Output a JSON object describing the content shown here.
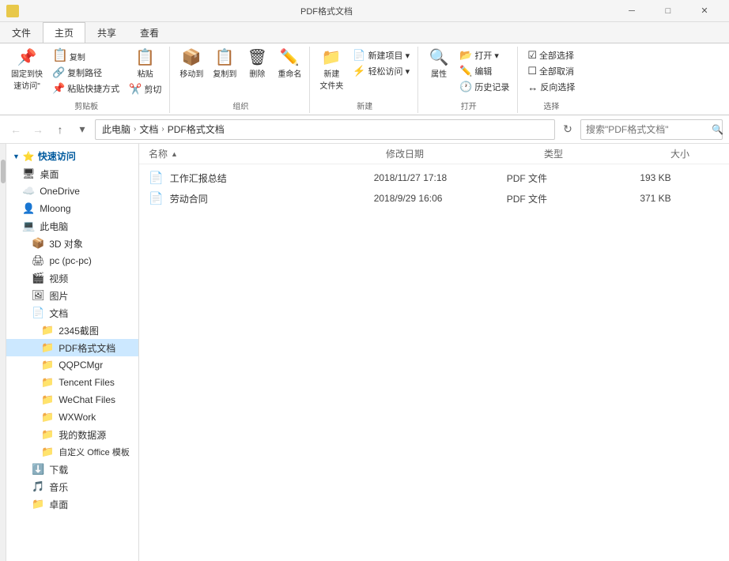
{
  "titleBar": {
    "title": "PDF格式文档",
    "icon": "📁",
    "controls": {
      "minimize": "─",
      "maximize": "□",
      "close": "✕"
    }
  },
  "ribbonTabs": [
    {
      "id": "file",
      "label": "文件",
      "active": false
    },
    {
      "id": "home",
      "label": "主页",
      "active": true
    },
    {
      "id": "share",
      "label": "共享",
      "active": false
    },
    {
      "id": "view",
      "label": "查看",
      "active": false
    }
  ],
  "ribbonGroups": [
    {
      "id": "clipboard",
      "label": "剪贴板",
      "items": [
        {
          "icon": "📌",
          "label": "固定到快\n速访问\"",
          "type": "large"
        },
        {
          "icon": "📋",
          "label": "复制",
          "type": "large"
        },
        {
          "icon": "📌",
          "label": "粘贴",
          "type": "large"
        },
        {
          "subItems": [
            {
              "icon": "🔗",
              "label": "复制路径"
            },
            {
              "icon": "🔗",
              "label": "粘贴快捷方式"
            },
            {
              "icon": "✂️",
              "label": "剪切"
            }
          ]
        }
      ]
    },
    {
      "id": "organize",
      "label": "组织",
      "items": [
        {
          "icon": "📦",
          "label": "移动到",
          "type": "large"
        },
        {
          "icon": "📋",
          "label": "复制到",
          "type": "large"
        },
        {
          "icon": "🗑",
          "label": "删除",
          "type": "large"
        },
        {
          "icon": "✏️",
          "label": "重命名",
          "type": "large"
        }
      ]
    },
    {
      "id": "new",
      "label": "新建",
      "items": [
        {
          "icon": "📁",
          "label": "新建\n文件夹",
          "type": "large"
        },
        {
          "subItems": [
            {
              "icon": "📄",
              "label": "新建项目 ▾"
            },
            {
              "icon": "⚡",
              "label": "轻松访问 ▾"
            }
          ]
        }
      ]
    },
    {
      "id": "open",
      "label": "打开",
      "items": [
        {
          "icon": "🔍",
          "label": "属性",
          "type": "large"
        },
        {
          "subItems": [
            {
              "icon": "📂",
              "label": "打开 ▾"
            },
            {
              "icon": "✏️",
              "label": "编辑"
            },
            {
              "icon": "🕐",
              "label": "历史记录"
            }
          ]
        }
      ]
    },
    {
      "id": "select",
      "label": "选择",
      "items": [
        {
          "subItems": [
            {
              "icon": "☑",
              "label": "全部选择"
            },
            {
              "icon": "☐",
              "label": "全部取消"
            },
            {
              "icon": "↔",
              "label": "反向选择"
            }
          ]
        }
      ]
    }
  ],
  "addressBar": {
    "backBtn": "←",
    "forwardBtn": "→",
    "upBtn": "↑",
    "recentBtn": "▾",
    "pathParts": [
      "此电脑",
      "文档",
      "PDF格式文档"
    ],
    "searchPlaceholder": "搜索\"PDF格式文档\""
  },
  "sidebar": {
    "sections": [
      {
        "label": "快速访问",
        "icon": "⭐",
        "items": [
          {
            "label": "桌面",
            "icon": "🖥",
            "type": "desktop"
          },
          {
            "label": "OneDrive",
            "icon": "☁️",
            "type": "cloud"
          },
          {
            "label": "Mloong",
            "icon": "👤",
            "type": "user"
          },
          {
            "label": "此电脑",
            "icon": "💻",
            "type": "computer"
          },
          {
            "label": "3D 对象",
            "icon": "📦",
            "type": "folder",
            "indent": 1
          },
          {
            "label": "pc (pc-pc)",
            "icon": "🖨",
            "type": "pc",
            "indent": 1
          },
          {
            "label": "视频",
            "icon": "🎬",
            "type": "folder",
            "indent": 1
          },
          {
            "label": "图片",
            "icon": "🖼",
            "type": "folder",
            "indent": 1
          },
          {
            "label": "文档",
            "icon": "📄",
            "type": "folder",
            "indent": 1
          },
          {
            "label": "2345截图",
            "icon": "📁",
            "type": "folder",
            "indent": 2
          },
          {
            "label": "PDF格式文档",
            "icon": "📁",
            "type": "folder",
            "indent": 2,
            "selected": true
          },
          {
            "label": "QQPCMgr",
            "icon": "📁",
            "type": "folder",
            "indent": 2
          },
          {
            "label": "Tencent Files",
            "icon": "📁",
            "type": "folder",
            "indent": 2
          },
          {
            "label": "WeChat Files",
            "icon": "📁",
            "type": "folder",
            "indent": 2
          },
          {
            "label": "WXWork",
            "icon": "📁",
            "type": "folder",
            "indent": 2
          },
          {
            "label": "我的数据源",
            "icon": "📁",
            "type": "folder-special",
            "indent": 2
          },
          {
            "label": "自定义 Office 模板",
            "icon": "📁",
            "type": "folder",
            "indent": 2
          },
          {
            "label": "下载",
            "icon": "⬇️",
            "type": "download",
            "indent": 1
          },
          {
            "label": "音乐",
            "icon": "🎵",
            "type": "folder",
            "indent": 1
          },
          {
            "label": "卓面",
            "icon": "📁",
            "type": "folder",
            "indent": 1
          }
        ]
      }
    ]
  },
  "fileList": {
    "columns": [
      {
        "id": "name",
        "label": "名称",
        "sort": "▲"
      },
      {
        "id": "date",
        "label": "修改日期"
      },
      {
        "id": "type",
        "label": "类型"
      },
      {
        "id": "size",
        "label": "大小"
      }
    ],
    "files": [
      {
        "name": "工作汇报总结",
        "icon": "📄",
        "date": "2018/11/27 17:18",
        "type": "PDF 文件",
        "size": "193 KB"
      },
      {
        "name": "劳动合同",
        "icon": "📄",
        "date": "2018/9/29 16:06",
        "type": "PDF 文件",
        "size": "371 KB"
      }
    ]
  }
}
